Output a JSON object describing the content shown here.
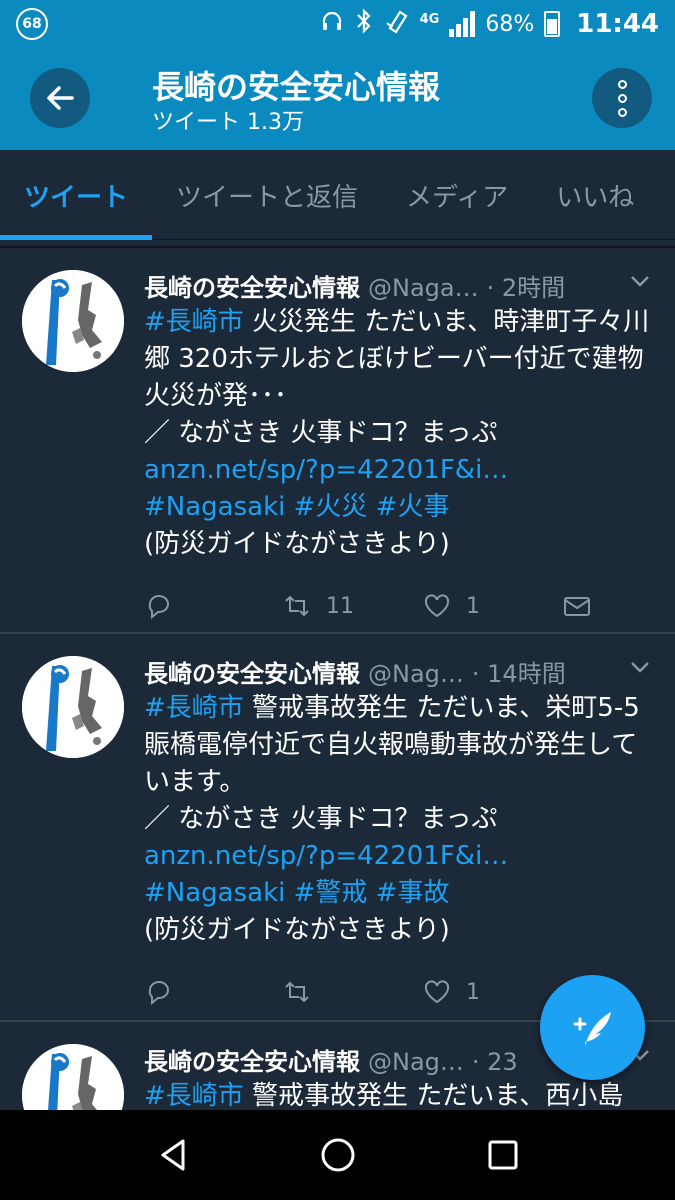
{
  "status_bar": {
    "notification_badge": "68",
    "network": "4G",
    "battery": "68%",
    "time": "11:44",
    "icons": [
      "headset-icon",
      "bluetooth-icon",
      "nfc-icon",
      "signal-icon",
      "battery-icon"
    ]
  },
  "header": {
    "title": "長崎の安全安心情報",
    "subtitle": "ツイート 1.3万"
  },
  "tabs": [
    {
      "label": "ツイート",
      "active": true
    },
    {
      "label": "ツイートと返信",
      "active": false
    },
    {
      "label": "メディア",
      "active": false
    },
    {
      "label": "いいね",
      "active": false
    }
  ],
  "tweets": [
    {
      "name": "長崎の安全安心情報",
      "handle": "@Naga…",
      "time": "· 2時間",
      "text": {
        "hashtag": "#長崎市",
        "line1": " 火災発生 ただいま、時津町子々川郷 320ホテルおとぼけビーバー付近で建物火災が発･･･",
        "map_label": "／ ながさき 火事ドコ？まっぷ ",
        "url": "anzn.net/sp/?p=42201F&i…",
        "tags": " #Nagasaki #火災 #火事",
        "source": "(防災ガイドながさきより)"
      },
      "retweets": "11",
      "likes": "1"
    },
    {
      "name": "長崎の安全安心情報",
      "handle": "@Nag…",
      "time": "· 14時間",
      "text": {
        "hashtag": "#長崎市",
        "line1": " 警戒事故発生 ただいま、栄町5-5賑橋電停付近で自火報鳴動事故が発生しています。",
        "map_label": "／ ながさき 火事ドコ？まっぷ ",
        "url": "anzn.net/sp/?p=42201F&i…",
        "tags": " #Nagasaki #警戒 #事故",
        "source": "(防災ガイドながさきより)"
      },
      "retweets": "",
      "likes": "1"
    },
    {
      "name": "長崎の安全安心情報",
      "handle": "@Nag…",
      "time": "· 23",
      "text": {
        "hashtag": "#長崎市",
        "line1": " 警戒事故発生 ただいま、西小島",
        "map_label": "",
        "url": "",
        "tags": "",
        "source": ""
      },
      "retweets": "",
      "likes": ""
    }
  ],
  "colors": {
    "header_bg": "#0b8ac0",
    "timeline_bg": "#1c2938",
    "accent": "#1da1f2",
    "secondary_text": "#8899a6"
  }
}
